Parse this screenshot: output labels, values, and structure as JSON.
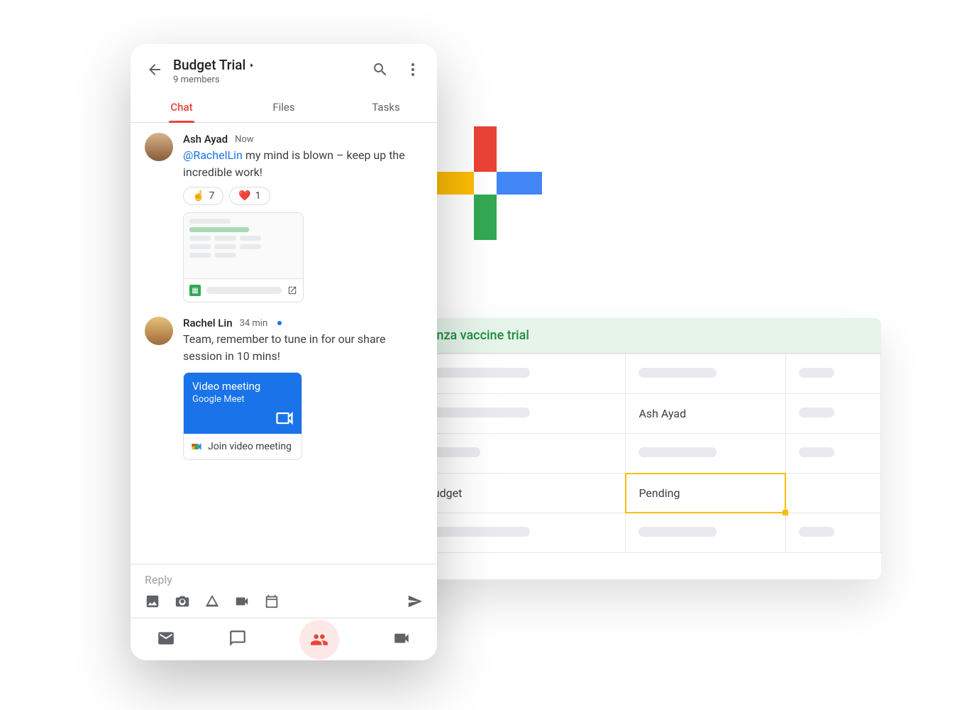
{
  "plus_colors": {
    "r": "#EA4335",
    "y": "#FBBC05",
    "b": "#4285F4",
    "g": "#34A853"
  },
  "sheet": {
    "title": "Influenza vaccine trial",
    "rows": [
      {
        "c1": "",
        "c2": "",
        "c3": ""
      },
      {
        "c1": "",
        "c2": "Ash Ayad",
        "c3": ""
      },
      {
        "c1": "",
        "c2": "",
        "c3": ""
      },
      {
        "c1": "Trial budget",
        "c2": "Pending",
        "c3": ""
      },
      {
        "c1": "",
        "c2": "",
        "c3": ""
      }
    ],
    "selected_cell": {
      "row": 3,
      "col": 1
    }
  },
  "phone": {
    "header": {
      "title": "Budget Trial",
      "subtitle": "9 members"
    },
    "tabs": [
      "Chat",
      "Files",
      "Tasks"
    ],
    "active_tab": 0,
    "messages": [
      {
        "author": "Ash Ayad",
        "time": "Now",
        "mention": "@RachelLin",
        "text": " my mind is blown – keep up the incredible work!",
        "reactions": [
          {
            "emoji": "☝️",
            "count": 7
          },
          {
            "emoji": "❤️",
            "count": 1
          }
        ],
        "attachment": "sheet"
      },
      {
        "author": "Rachel Lin",
        "time": "34 min",
        "unread": true,
        "text": "Team, remember to tune in for our share session in 10 mins!",
        "meet": {
          "title": "Video meeting",
          "subtitle": "Google Meet",
          "cta": "Join video meeting"
        }
      }
    ],
    "reply_placeholder": "Reply",
    "composer_icons": [
      "image-icon",
      "camera-icon",
      "drive-icon",
      "video-icon",
      "calendar-icon"
    ],
    "bottom_nav": [
      "mail-icon",
      "chat-icon",
      "spaces-icon",
      "meet-icon"
    ],
    "bottom_nav_selected": 2
  }
}
